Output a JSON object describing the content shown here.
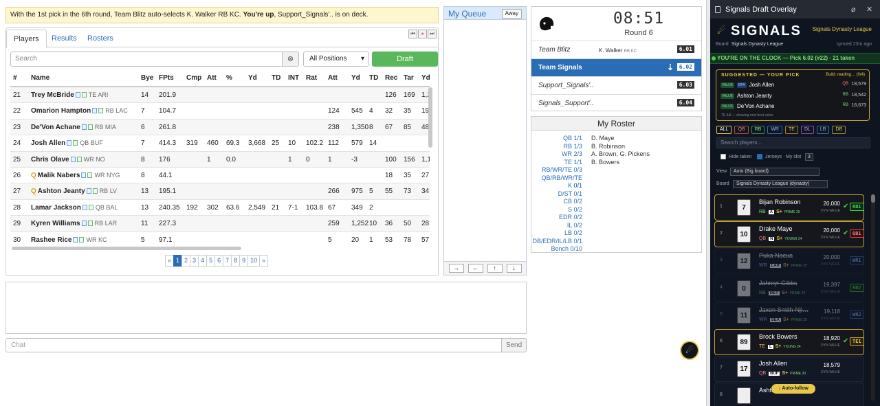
{
  "notice": {
    "prefix": "With the 1st pick in the 6th round, Team Blitz auto-selects K. Walker RB KC.",
    "bold": "You're up",
    "suffix": ", Support_Signals'.. is on deck."
  },
  "tabs": [
    "Players",
    "Results",
    "Rosters"
  ],
  "search": {
    "placeholder": "Search"
  },
  "positions_filter": "All Positions",
  "draft_button": "Draft",
  "grid": {
    "headers": [
      "#",
      "Name",
      "Bye",
      "FPts",
      "Cmp",
      "Att",
      "%",
      "Yd",
      "TD",
      "INT",
      "Rat",
      "Att",
      "Yd",
      "TD",
      "Rec",
      "Tar",
      "Yd"
    ],
    "rows": [
      {
        "rank": "21",
        "q": "",
        "name": "Trey McBride",
        "pos": "TE ARI",
        "bye": "14",
        "fpts": "201.9",
        "cmp": "",
        "att": "",
        "pct": "",
        "yd": "",
        "td": "",
        "int": "",
        "rat": "",
        "ratt": "",
        "ryd": "",
        "rtd": "",
        "rec": "126",
        "tar": "169",
        "recyd": "1,2"
      },
      {
        "rank": "22",
        "q": "",
        "name": "Omarion Hampton",
        "pos": "RB LAC",
        "bye": "7",
        "fpts": "104.7",
        "cmp": "",
        "att": "",
        "pct": "",
        "yd": "",
        "td": "",
        "int": "",
        "rat": "",
        "ratt": "124",
        "ryd": "545",
        "rtd": "4",
        "rec": "32",
        "tar": "35",
        "recyd": "19"
      },
      {
        "rank": "23",
        "q": "",
        "name": "De'Von Achane",
        "pos": "RB MIA",
        "bye": "6",
        "fpts": "261.8",
        "cmp": "",
        "att": "",
        "pct": "",
        "yd": "",
        "td": "",
        "int": "",
        "rat": "",
        "ratt": "238",
        "ryd": "1,350",
        "rtd": "8",
        "rec": "67",
        "tar": "85",
        "recyd": "48"
      },
      {
        "rank": "24",
        "q": "",
        "name": "Josh Allen",
        "pos": "QB BUF",
        "bye": "7",
        "fpts": "414.3",
        "cmp": "319",
        "att": "460",
        "pct": "69.3",
        "yd": "3,668",
        "td": "25",
        "int": "10",
        "rat": "102.2",
        "ratt": "112",
        "ryd": "579",
        "rtd": "14",
        "rec": "",
        "tar": "",
        "recyd": ""
      },
      {
        "rank": "25",
        "q": "",
        "name": "Chris Olave",
        "pos": "WR NO",
        "bye": "8",
        "fpts": "176",
        "cmp": "",
        "att": "1",
        "pct": "0.0",
        "yd": "",
        "td": "",
        "int": "1",
        "rat": "0",
        "ratt": "1",
        "ryd": "-3",
        "rtd": "",
        "rec": "100",
        "tar": "156",
        "recyd": "1,1"
      },
      {
        "rank": "26",
        "q": "Q",
        "name": "Malik Nabers",
        "pos": "WR NYG",
        "bye": "8",
        "fpts": "44.1",
        "cmp": "",
        "att": "",
        "pct": "",
        "yd": "",
        "td": "",
        "int": "",
        "rat": "",
        "ratt": "",
        "ryd": "",
        "rtd": "",
        "rec": "18",
        "tar": "35",
        "recyd": "27"
      },
      {
        "rank": "27",
        "q": "Q",
        "name": "Ashton Jeanty",
        "pos": "RB LV",
        "bye": "13",
        "fpts": "195.1",
        "cmp": "",
        "att": "",
        "pct": "",
        "yd": "",
        "td": "",
        "int": "",
        "rat": "",
        "ratt": "266",
        "ryd": "975",
        "rtd": "5",
        "rec": "55",
        "tar": "73",
        "recyd": "34"
      },
      {
        "rank": "28",
        "q": "",
        "name": "Lamar Jackson",
        "pos": "QB BAL",
        "bye": "13",
        "fpts": "240.35",
        "cmp": "192",
        "att": "302",
        "pct": "63.6",
        "yd": "2,549",
        "td": "21",
        "int": "7-1",
        "rat": "103.8",
        "ratt": "67",
        "ryd": "349",
        "rtd": "2",
        "rec": "",
        "tar": "",
        "recyd": ""
      },
      {
        "rank": "29",
        "q": "",
        "name": "Kyren Williams",
        "pos": "RB LAR",
        "bye": "11",
        "fpts": "227.3",
        "cmp": "",
        "att": "",
        "pct": "",
        "yd": "",
        "td": "",
        "int": "",
        "rat": "",
        "ratt": "259",
        "ryd": "1,252",
        "rtd": "10",
        "rec": "36",
        "tar": "50",
        "recyd": "28"
      },
      {
        "rank": "30",
        "q": "",
        "name": "Rashee Rice",
        "pos": "WR KC",
        "bye": "5",
        "fpts": "97.1",
        "cmp": "",
        "att": "",
        "pct": "",
        "yd": "",
        "td": "",
        "int": "",
        "rat": "",
        "ratt": "5",
        "ryd": "20",
        "rtd": "1",
        "rec": "53",
        "tar": "78",
        "recyd": "57"
      }
    ]
  },
  "pager": [
    "«",
    "1",
    "2",
    "3",
    "4",
    "5",
    "6",
    "7",
    "8",
    "9",
    "10",
    "»"
  ],
  "chat": {
    "placeholder": "Chat",
    "send": "Send"
  },
  "queue": {
    "title": "My Queue",
    "away": "Away"
  },
  "clock": {
    "time": "08:51",
    "round": "Round 6",
    "order": [
      {
        "team": "Team Blitz",
        "sub": "K. Walker",
        "sub_pos": "RB KC",
        "pick": "6.01"
      },
      {
        "team": "Team Signals",
        "sub": "",
        "sub_pos": "",
        "pick": "6.02"
      },
      {
        "team": "Support_Signals'..",
        "sub": "",
        "sub_pos": "",
        "pick": "6.03"
      },
      {
        "team": "Signals_Support'..",
        "sub": "",
        "sub_pos": "",
        "pick": "6.04"
      }
    ]
  },
  "roster": {
    "title": "My Roster",
    "rows": [
      {
        "slot": "QB 1/1",
        "names": "D. Maye"
      },
      {
        "slot": "RB 1/3",
        "names": "B. Robinson"
      },
      {
        "slot": "WR 2/3",
        "names": "A. Brown, G. Pickens"
      },
      {
        "slot": "TE 1/1",
        "names": "B. Bowers"
      },
      {
        "slot": "RB/WR/TE 0/3",
        "names": ""
      },
      {
        "slot": "QB/RB/WR/TE 0/1",
        "names": ""
      },
      {
        "slot": "K 0/1",
        "names": ""
      },
      {
        "slot": "D/ST 0/1",
        "names": ""
      },
      {
        "slot": "CB 0/2",
        "names": ""
      },
      {
        "slot": "S 0/2",
        "names": ""
      },
      {
        "slot": "EDR 0/2",
        "names": ""
      },
      {
        "slot": "IL 0/2",
        "names": ""
      },
      {
        "slot": "LB 0/2",
        "names": ""
      },
      {
        "slot": "DB/EDR/IL/LB 0/1",
        "names": ""
      },
      {
        "slot": "Bench 0/10",
        "names": ""
      }
    ]
  },
  "overlay": {
    "title": "Signals Draft Overlay",
    "brand": "SIGNALS",
    "league_name": "Signals Dynasty League",
    "board_label": "Board",
    "board_value": "Signals Dynasty League",
    "synced": "synced 23m ago",
    "on_clock": "YOU'RE ON THE CLOCK — Pick 6.02 (#22) · 21 taken",
    "suggest_title": "SUGGESTED — YOUR PICK",
    "suggest_build": "Build: reading… (0/4)",
    "suggestions": [
      {
        "tag": "VALUE",
        "tag2": "BPA",
        "name": "Josh Allen",
        "pos": "QB",
        "value": "18,579"
      },
      {
        "tag": "VALUE",
        "tag2": "",
        "name": "Ashton Jeanty",
        "pos": "RB",
        "value": "18,542"
      },
      {
        "tag": "VALUE",
        "tag2": "",
        "name": "De'Von Achane",
        "pos": "RB",
        "value": "16,673"
      }
    ],
    "suggest_note": "TE full — showing next best value.",
    "chips": [
      "ALL",
      "QB",
      "RB",
      "WR",
      "TE",
      "DL",
      "LB",
      "DB"
    ],
    "search_placeholder": "Search players...",
    "hide_taken": "Hide taken",
    "jerseys": "Jerseys",
    "my_slot_label": "My slot",
    "my_slot_value": "3",
    "view_label": "View",
    "view_value": "Auto (Big board)",
    "board_row_label": "Board",
    "board_row_value": "Signals Dynasty League (dynasty)",
    "value_label": "DYN VALUE",
    "cards": [
      {
        "num": "1",
        "jersey": "7",
        "name": "Bijan Robinson",
        "pos": "RB",
        "team": "A",
        "grade": "S+",
        "age": "PRIME 25",
        "value": "20,000",
        "slot": "RB1",
        "check": "✔",
        "style": "gold",
        "pcls": "",
        "scls": ""
      },
      {
        "num": "2",
        "jersey": "10",
        "name": "Drake Maye",
        "pos": "QB",
        "team": "N",
        "grade": "S+",
        "age": "YOUNG 24",
        "value": "20,000",
        "slot": "QB1",
        "check": "✔",
        "style": "gold",
        "pcls": "qb",
        "scls": "qb"
      },
      {
        "num": "3",
        "jersey": "12",
        "name": "Puka Nacua",
        "pos": "WR",
        "team": "LAR",
        "grade": "S+",
        "age": "PRIME 25",
        "value": "20,000",
        "slot": "WR1",
        "check": "",
        "style": "dim",
        "pcls": "wr",
        "scls": "wr"
      },
      {
        "num": "4",
        "jersey": "0",
        "name": "Jahmyr Gibbs",
        "pos": "RB",
        "team": "DET",
        "grade": "S+",
        "age": "PRIME 24",
        "value": "19,397",
        "slot": "RB2",
        "check": "",
        "style": "dim",
        "pcls": "",
        "scls": ""
      },
      {
        "num": "5",
        "jersey": "11",
        "name": "Jaxon Smith-Nji…",
        "pos": "WR",
        "team": "SEA",
        "grade": "S+",
        "age": "PRIME 25",
        "value": "19,118",
        "slot": "WR2",
        "check": "",
        "style": "dim",
        "pcls": "wr",
        "scls": "wr"
      },
      {
        "num": "6",
        "jersey": "89",
        "name": "Brock Bowers",
        "pos": "TE",
        "team": "L",
        "grade": "S+",
        "age": "YOUNG 24",
        "value": "18,920",
        "slot": "TE1",
        "check": "✔",
        "style": "gold",
        "pcls": "te",
        "scls": "te"
      },
      {
        "num": "7",
        "jersey": "17",
        "name": "Josh Allen",
        "pos": "QB",
        "team": "BUF",
        "grade": "S+",
        "age": "PRIME 30",
        "value": "18,579",
        "slot": "",
        "check": "",
        "style": "",
        "pcls": "qb",
        "scls": ""
      },
      {
        "num": "8",
        "jersey": "",
        "name": "Ashton Jeanty",
        "pos": "",
        "team": "",
        "grade": "",
        "age": "",
        "value": "",
        "slot": "",
        "check": "",
        "style": "",
        "pcls": "",
        "scls": ""
      }
    ],
    "autofollow": "↓ Auto-follow"
  }
}
